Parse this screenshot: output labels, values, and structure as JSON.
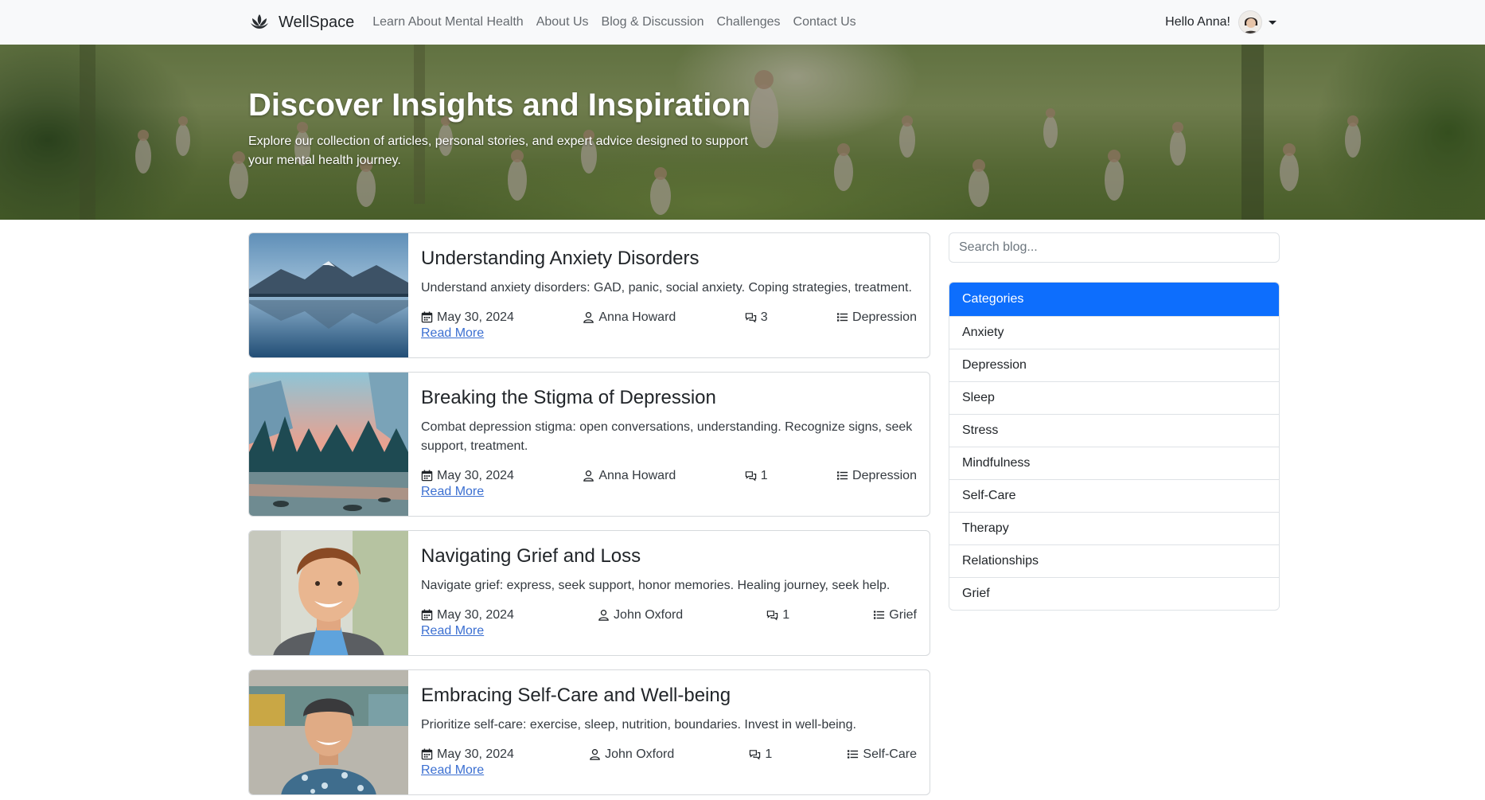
{
  "navbar": {
    "brand": "WellSpace",
    "links": [
      {
        "label": "Learn About Mental Health"
      },
      {
        "label": "About Us"
      },
      {
        "label": "Blog & Discussion"
      },
      {
        "label": "Challenges"
      },
      {
        "label": "Contact Us"
      }
    ],
    "greeting": "Hello Anna!"
  },
  "hero": {
    "title": "Discover Insights and Inspiration",
    "subtitle_line1": "Explore our collection of articles, personal stories, and expert advice designed to support",
    "subtitle_line2": "your mental health journey."
  },
  "posts": [
    {
      "title": "Understanding Anxiety Disorders",
      "excerpt": "Understand anxiety disorders: GAD, panic, social anxiety. Coping strategies, treatment.",
      "date": "May 30, 2024",
      "author": "Anna Howard",
      "comments": "3",
      "category": "Depression",
      "read_more": "Read More",
      "image": "mountain-lake"
    },
    {
      "title": "Breaking the Stigma of Depression",
      "excerpt": "Combat depression stigma: open conversations, understanding. Recognize signs, seek support, treatment.",
      "date": "May 30, 2024",
      "author": "Anna Howard",
      "comments": "1",
      "category": "Depression",
      "read_more": "Read More",
      "image": "forest-river-sunset"
    },
    {
      "title": "Navigating Grief and Loss",
      "excerpt": "Navigate grief: express, seek support, honor memories. Healing journey, seek help.",
      "date": "May 30, 2024",
      "author": "John Oxford",
      "comments": "1",
      "category": "Grief",
      "read_more": "Read More",
      "image": "smiling-young-man"
    },
    {
      "title": "Embracing Self-Care and Well-being",
      "excerpt": "Prioritize self-care: exercise, sleep, nutrition, boundaries. Invest in well-being.",
      "date": "May 30, 2024",
      "author": "John Oxford",
      "comments": "1",
      "category": "Self-Care",
      "read_more": "Read More",
      "image": "man-with-cap"
    }
  ],
  "sidebar": {
    "search_placeholder": "Search blog...",
    "categories_header": "Categories",
    "categories": [
      {
        "label": "Anxiety"
      },
      {
        "label": "Depression"
      },
      {
        "label": "Sleep"
      },
      {
        "label": "Stress"
      },
      {
        "label": "Mindfulness"
      },
      {
        "label": "Self-Care"
      },
      {
        "label": "Therapy"
      },
      {
        "label": "Relationships"
      },
      {
        "label": "Grief"
      }
    ]
  },
  "colors": {
    "primary": "#0d6efd",
    "link": "#3b6fd1",
    "navbar_bg": "#f8f9fa"
  }
}
